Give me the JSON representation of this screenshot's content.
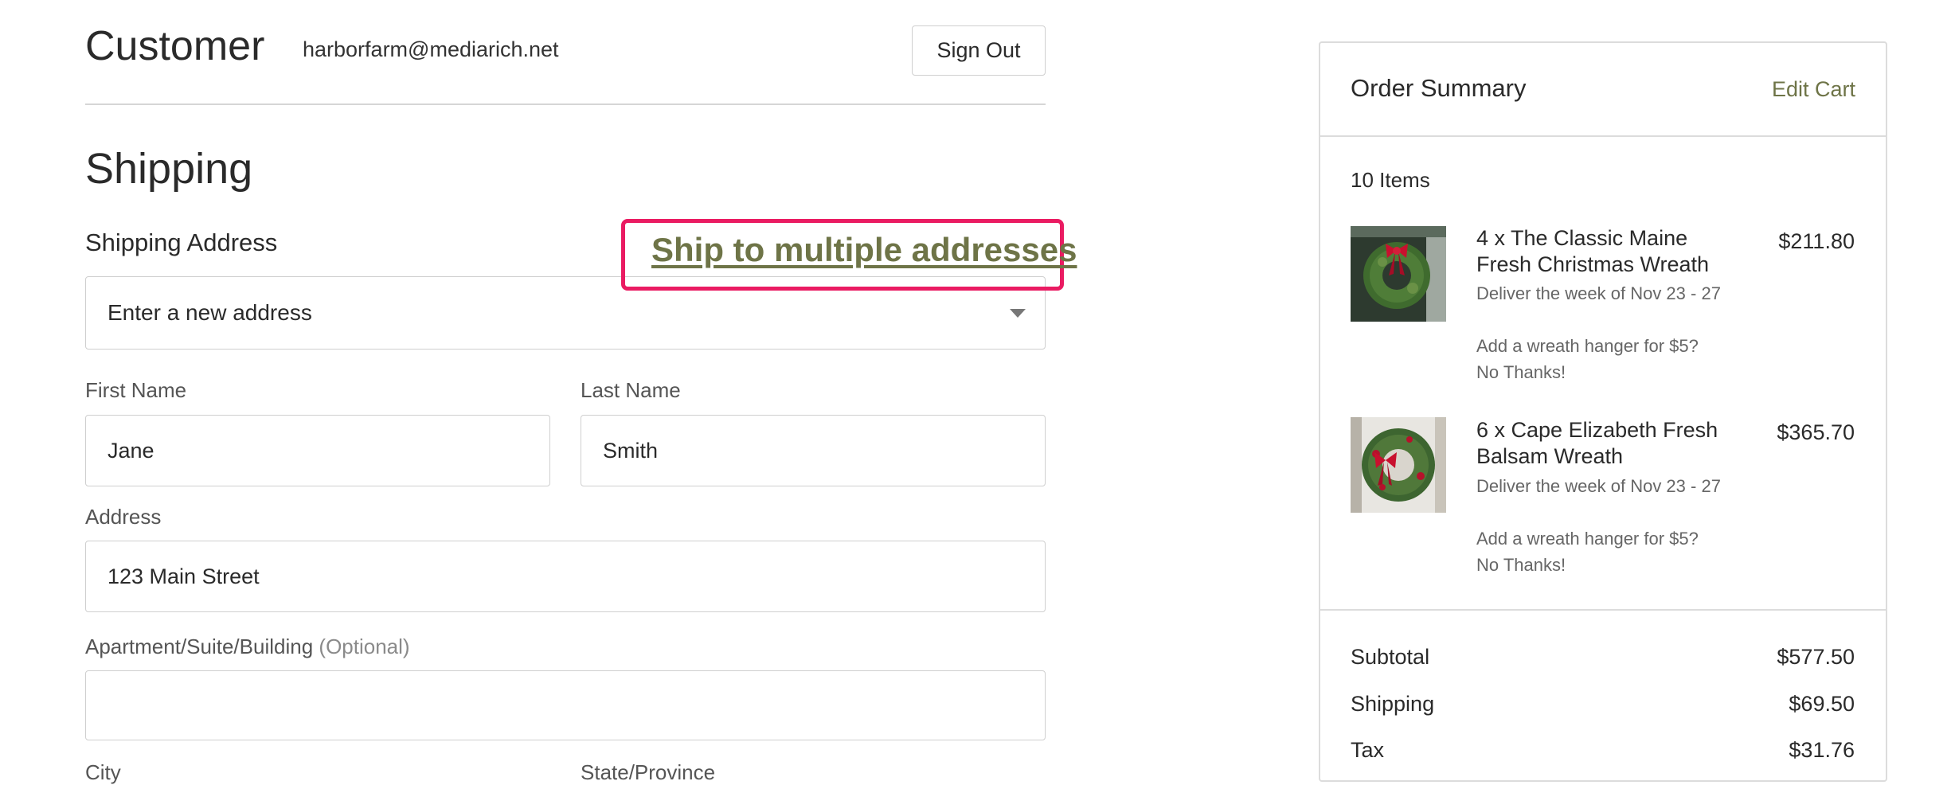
{
  "customer": {
    "title": "Customer",
    "email": "harborfarm@mediarich.net",
    "sign_out_label": "Sign Out"
  },
  "shipping": {
    "title": "Shipping",
    "address_label": "Shipping Address",
    "multi_link": "Ship to multiple addresses",
    "address_select": "Enter a new address",
    "first_name": {
      "label": "First Name",
      "value": "Jane"
    },
    "last_name": {
      "label": "Last Name",
      "value": "Smith"
    },
    "address": {
      "label": "Address",
      "value": "123 Main Street"
    },
    "apartment": {
      "label": "Apartment/Suite/Building",
      "optional": "(Optional)",
      "value": ""
    },
    "city": {
      "label": "City"
    },
    "state": {
      "label": "State/Province"
    }
  },
  "summary": {
    "title": "Order Summary",
    "edit_cart": "Edit Cart",
    "items_count": "10 Items",
    "items": [
      {
        "title": "4 x The Classic Maine Fresh Christmas Wreath",
        "delivery": "Deliver the week of Nov 23 - 27",
        "hanger": "Add a wreath hanger for $5?",
        "hanger_choice": "No Thanks!",
        "price": "$211.80"
      },
      {
        "title": "6 x Cape Elizabeth Fresh Balsam Wreath",
        "delivery": "Deliver the week of Nov 23 - 27",
        "hanger": "Add a wreath hanger for $5?",
        "hanger_choice": "No Thanks!",
        "price": "$365.70"
      }
    ],
    "subtotal": {
      "label": "Subtotal",
      "value": "$577.50"
    },
    "shipping": {
      "label": "Shipping",
      "value": "$69.50"
    },
    "tax": {
      "label": "Tax",
      "value": "$31.76"
    }
  },
  "colors": {
    "accent": "#6e7447",
    "highlight": "#ea1b62"
  }
}
